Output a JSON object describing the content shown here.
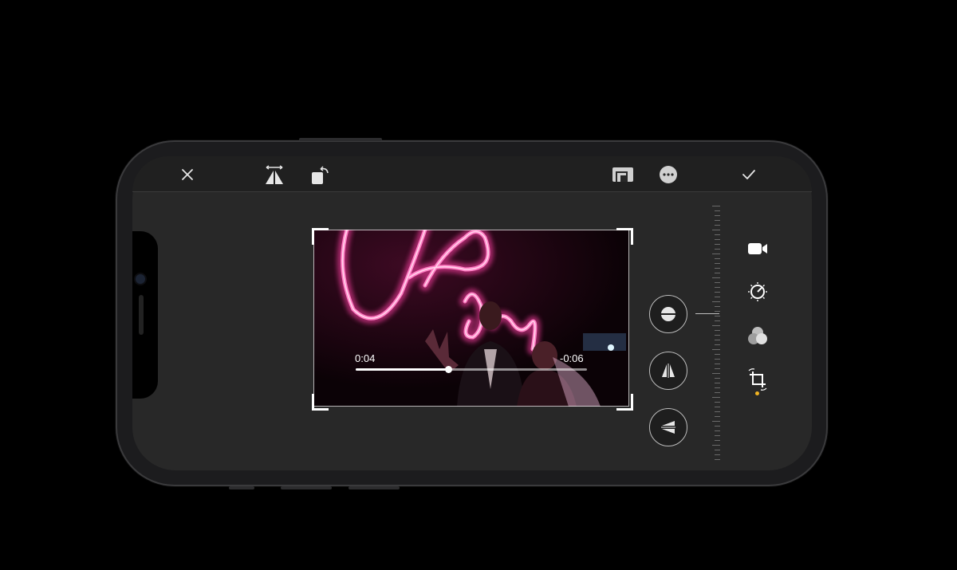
{
  "editor": {
    "toolbar": {
      "close_icon": "close-icon",
      "flip_icon": "flip-horizontal-icon",
      "rotate_icon": "rotate-icon",
      "aspect_icon": "aspect-ratio-icon",
      "more_icon": "more-icon",
      "done_icon": "checkmark-icon"
    },
    "video": {
      "elapsed": "0:04",
      "remaining": "-0:06",
      "progress": 0.4
    },
    "straighten_tools": [
      {
        "name": "straighten-icon",
        "selected": true
      },
      {
        "name": "vertical-perspective-icon",
        "selected": false
      },
      {
        "name": "horizontal-perspective-icon",
        "selected": false
      }
    ],
    "side_tools": [
      {
        "name": "video-icon"
      },
      {
        "name": "adjust-dial-icon"
      },
      {
        "name": "filters-icon"
      },
      {
        "name": "crop-rotate-icon",
        "active": true
      }
    ],
    "colors": {
      "accent": "#f0b323",
      "neon": "#ff3fa4",
      "background": "#282828"
    }
  }
}
